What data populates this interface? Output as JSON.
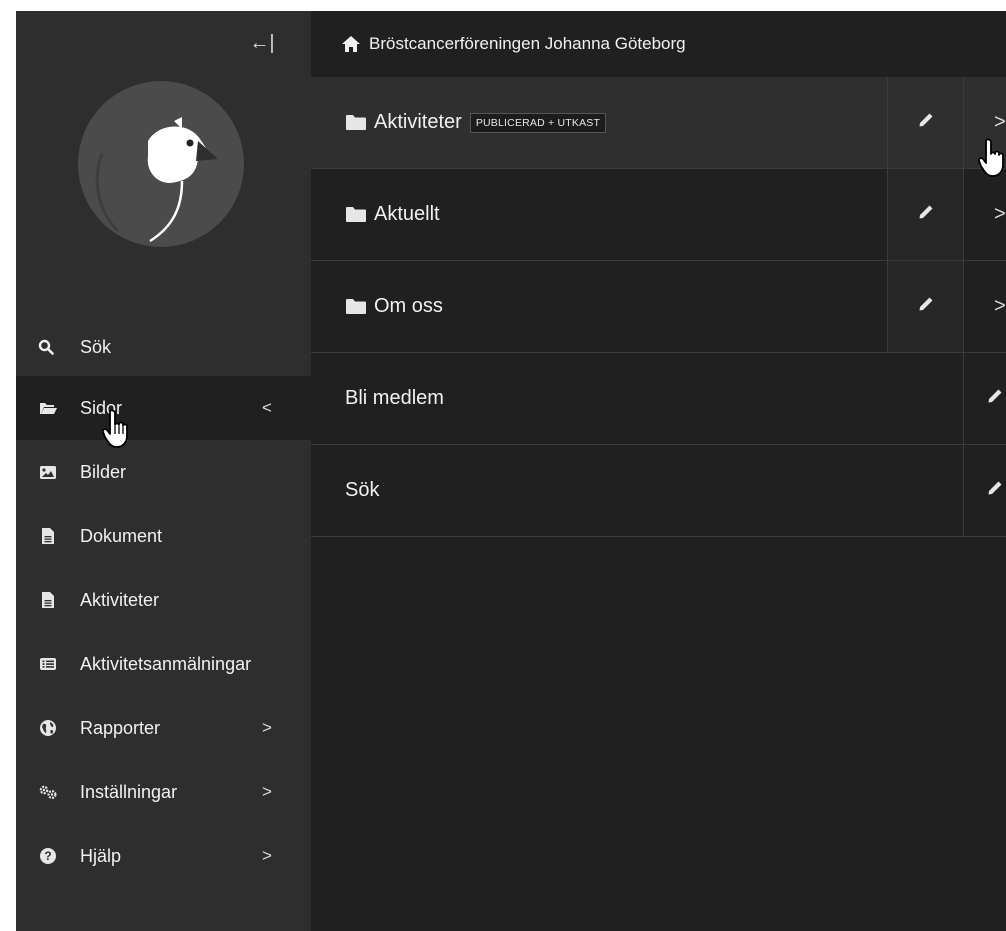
{
  "sidebar": {
    "collapse_icon": "arrow-left-to-bar-icon",
    "collapse_glyph": "←|",
    "logo_icon": "bird-logo",
    "search": {
      "label": "Sök",
      "icon": "search-icon"
    },
    "items": [
      {
        "label": "Sidor",
        "icon": "folder-open-icon",
        "chevron": "<",
        "active": true
      },
      {
        "label": "Bilder",
        "icon": "image-icon",
        "chevron": ""
      },
      {
        "label": "Dokument",
        "icon": "document-icon",
        "chevron": ""
      },
      {
        "label": "Aktiviteter",
        "icon": "document-icon",
        "chevron": ""
      },
      {
        "label": "Aktivitetsanmälningar",
        "icon": "list-icon",
        "chevron": ""
      },
      {
        "label": "Rapporter",
        "icon": "globe-icon",
        "chevron": ">"
      },
      {
        "label": "Inställningar",
        "icon": "cogs-icon",
        "chevron": ">"
      },
      {
        "label": "Hjälp",
        "icon": "help-icon",
        "chevron": ">"
      }
    ]
  },
  "main": {
    "breadcrumb": {
      "label": "Bröstcancerföreningen Johanna Göteborg",
      "icon": "home-icon"
    },
    "rows": [
      {
        "title": "Aktiviteter",
        "badge": "PUBLICERAD + UTKAST",
        "has_children": true,
        "open_glyph": ">"
      },
      {
        "title": "Aktuellt",
        "badge": "",
        "has_children": true,
        "open_glyph": ">"
      },
      {
        "title": "Om oss",
        "badge": "",
        "has_children": true,
        "open_glyph": ">"
      },
      {
        "title": "Bli medlem",
        "badge": "",
        "has_children": false
      },
      {
        "title": "Sök",
        "badge": "",
        "has_children": false
      }
    ]
  },
  "colors": {
    "sidebar_bg": "#2e2e2e",
    "main_bg": "#202020",
    "active_bg": "#202020",
    "highlight_row_bg": "#2f2f2f",
    "text": "#f1f1f1"
  }
}
